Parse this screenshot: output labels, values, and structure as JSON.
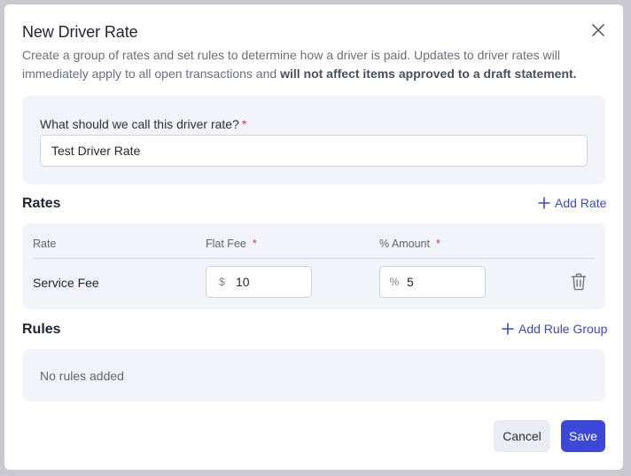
{
  "dialog": {
    "title": "New Driver Rate",
    "description_plain": "Create a group of rates and set rules to determine how a driver is paid. Updates to driver rates will immediately apply to all open transactions and ",
    "description_bold": "will not affect items approved to a draft statement."
  },
  "name_field": {
    "label": "What should we call this driver rate?",
    "required_mark": "*",
    "value": "Test Driver Rate"
  },
  "rates": {
    "title": "Rates",
    "add_label": "Add Rate",
    "columns": {
      "rate": "Rate",
      "flat_fee": "Flat Fee",
      "amount": "% Amount",
      "required_mark": "*"
    },
    "rows": [
      {
        "name": "Service Fee",
        "flat_fee_prefix": "$",
        "flat_fee": "10",
        "amount_prefix": "%",
        "amount": "5"
      }
    ]
  },
  "rules": {
    "title": "Rules",
    "add_label": "Add Rule Group",
    "empty_text": "No rules added"
  },
  "footer": {
    "cancel_label": "Cancel",
    "save_label": "Save"
  },
  "colors": {
    "accent": "#3d47d8",
    "link": "#3d47c8",
    "required": "#d6344a",
    "panel": "#f3f4f9"
  }
}
